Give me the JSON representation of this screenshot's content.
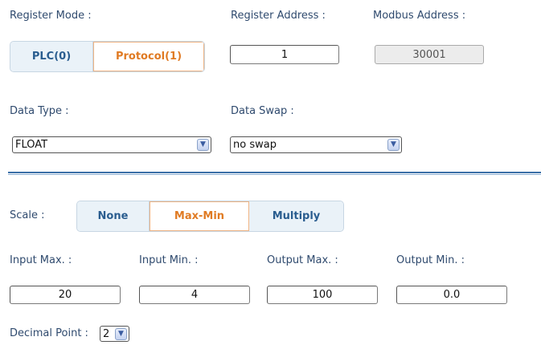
{
  "register": {
    "mode_label": "Register Mode :",
    "mode_options": [
      "PLC(0)",
      "Protocol(1)"
    ],
    "mode_selected": "Protocol(1)",
    "address_label": "Register Address :",
    "address_value": "1",
    "modbus_label": "Modbus Address :",
    "modbus_value": "30001"
  },
  "data": {
    "type_label": "Data Type :",
    "type_value": "FLOAT",
    "swap_label": "Data Swap :",
    "swap_value": "no swap"
  },
  "scale": {
    "label": "Scale :",
    "options": [
      "None",
      "Max-Min",
      "Multiply"
    ],
    "selected": "Max-Min"
  },
  "range": {
    "input_max_label": "Input Max. :",
    "input_max": "20",
    "input_min_label": "Input Min. :",
    "input_min": "4",
    "output_max_label": "Output Max. :",
    "output_max": "100",
    "output_min_label": "Output Min. :",
    "output_min": "0.0"
  },
  "decimal": {
    "label": "Decimal Point :",
    "value": "2"
  },
  "colors": {
    "accent": "#e07b24",
    "primary": "#2a5d8f",
    "divider": "#3b6fa7"
  },
  "icons": {
    "dropdown": "chevron-down-icon"
  }
}
